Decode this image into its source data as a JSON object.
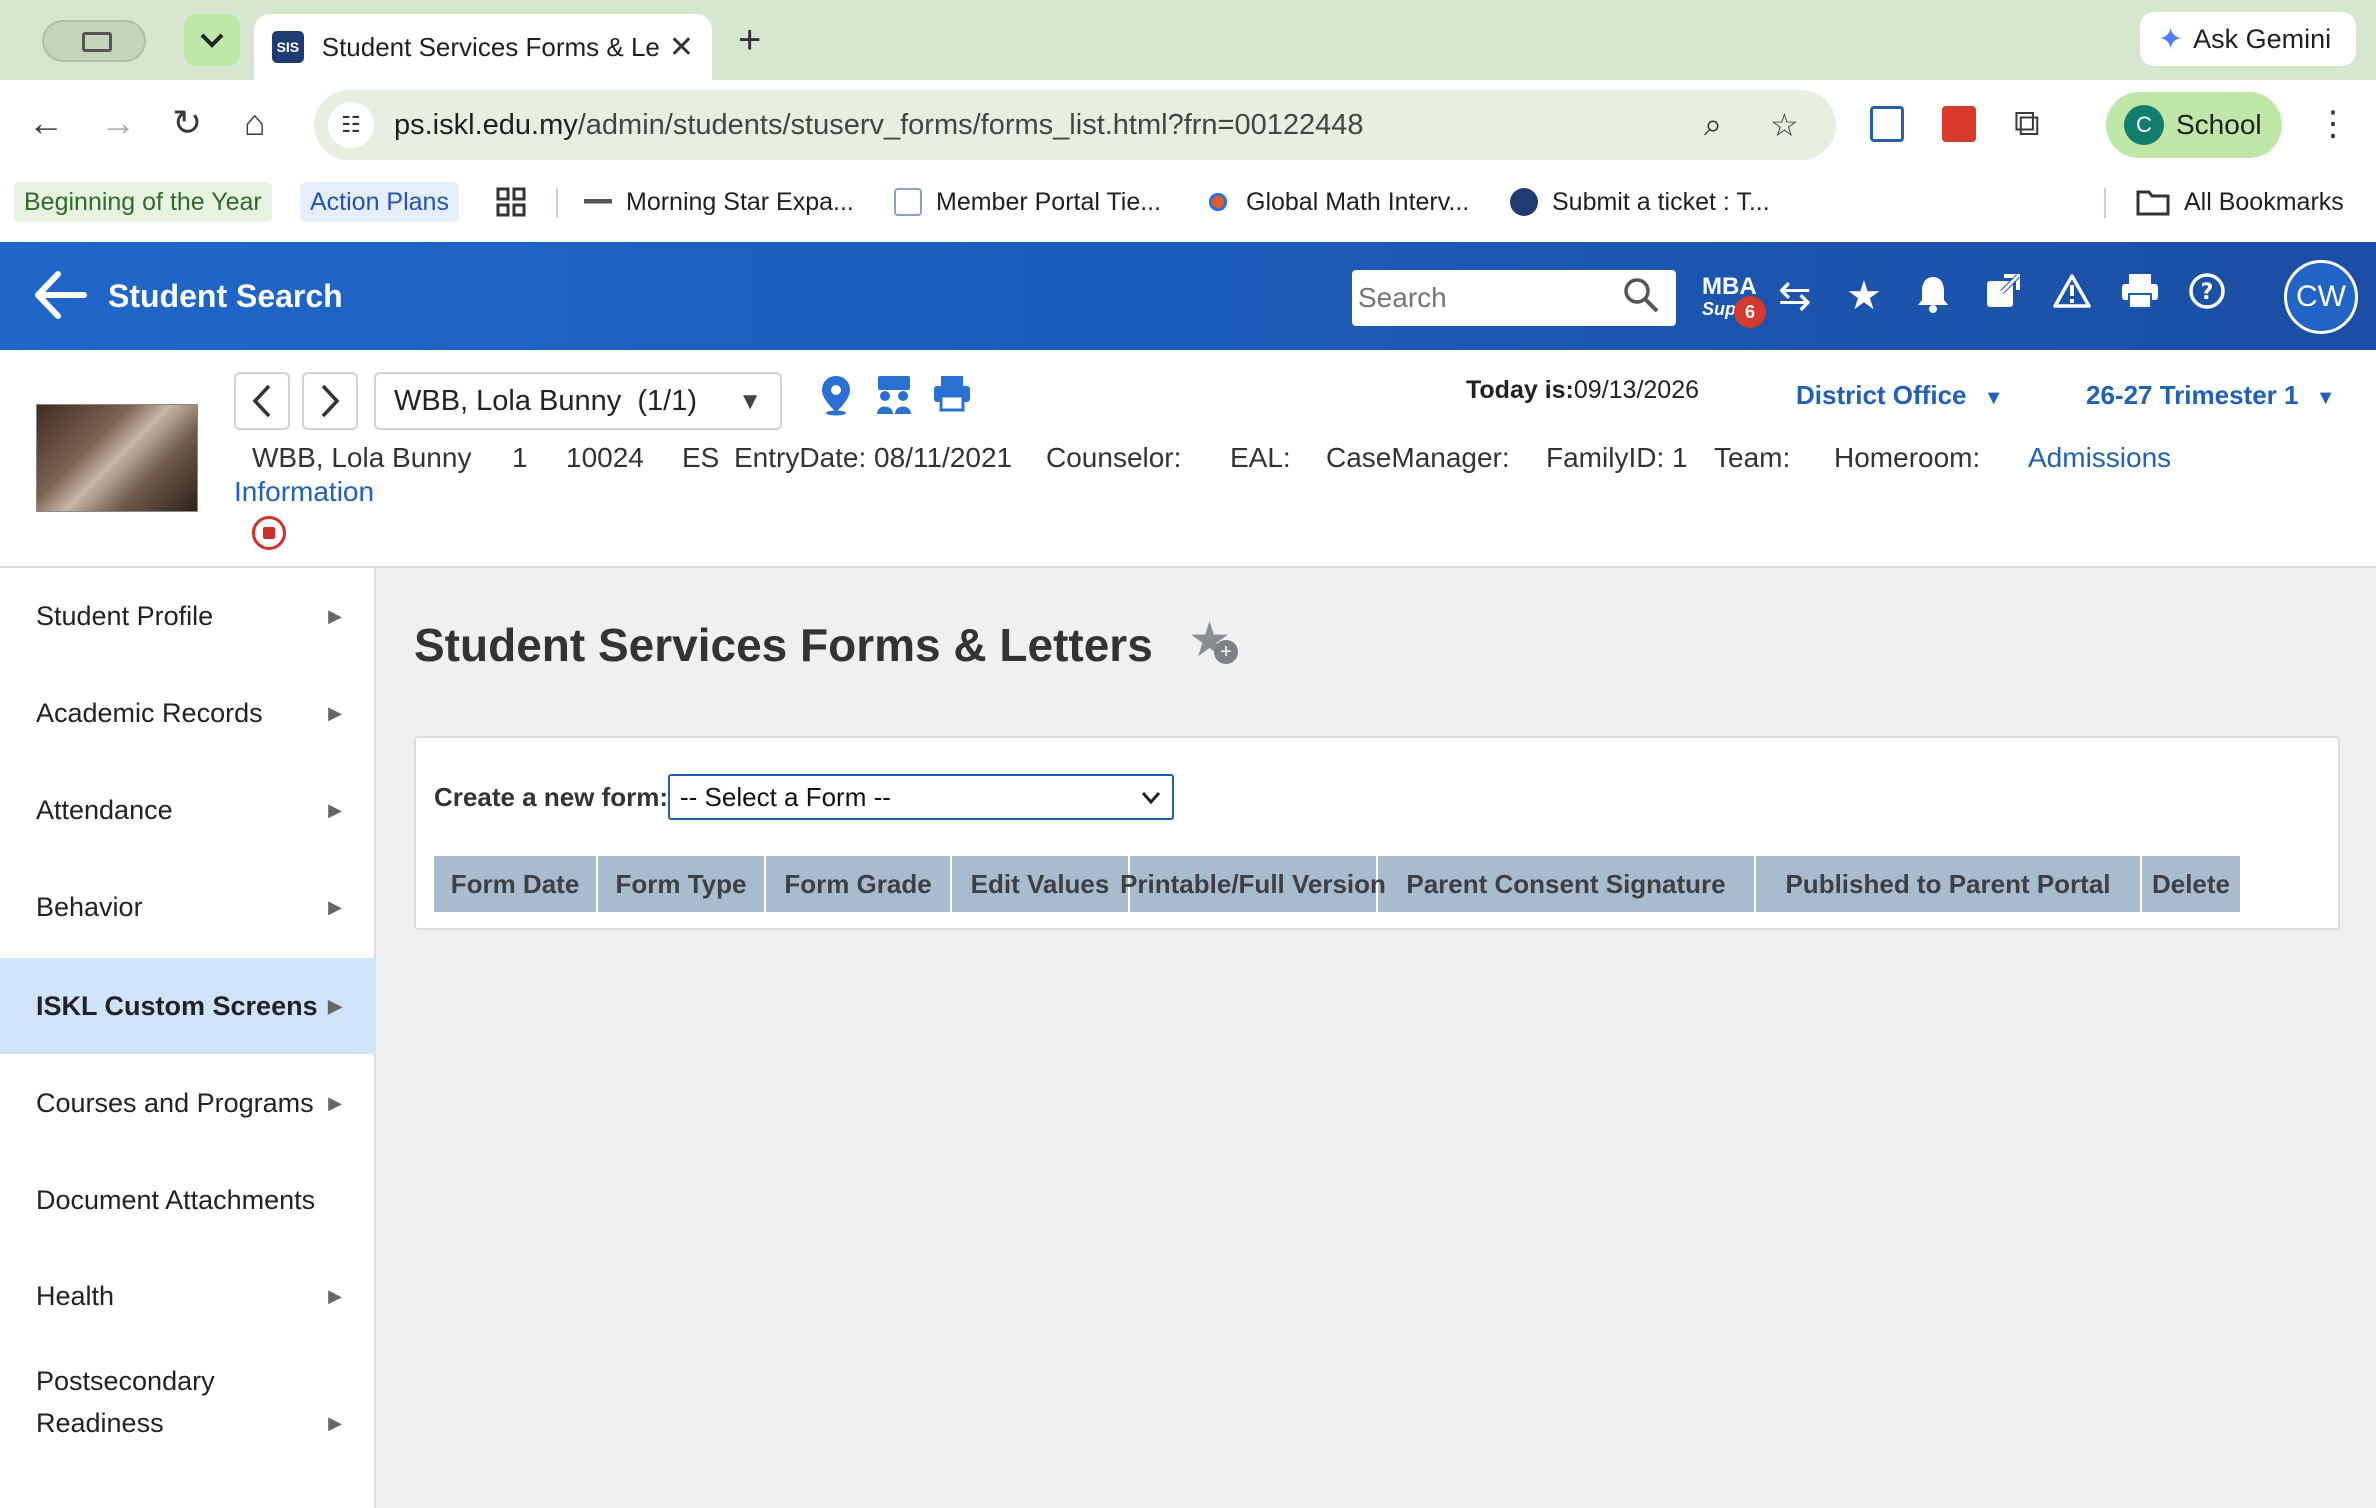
{
  "browser": {
    "tab": {
      "favicon_text": "SIS",
      "title": "Student Services Forms & Letters"
    },
    "gemini_label": "Ask Gemini",
    "url_host": "ps.iskl.edu.my",
    "url_path": "/admin/students/stuserv_forms/forms_list.html?frn=00122448",
    "profile": {
      "initial": "C",
      "label": "School"
    },
    "bookmarks": [
      {
        "label": "Beginning of the Year"
      },
      {
        "label": "Action Plans"
      },
      {
        "label": "Morning Star Expa..."
      },
      {
        "label": "Member Portal Tie..."
      },
      {
        "label": "Global Math Interv..."
      },
      {
        "label": "Submit a ticket : T..."
      }
    ],
    "all_bookmarks": "All Bookmarks"
  },
  "header": {
    "title": "Student Search",
    "search_placeholder": "Search",
    "mba_line1": "MBA",
    "mba_line2": "Supp",
    "mba_badge": "6",
    "user_initials": "CW"
  },
  "student": {
    "selector_label": "WBB, Lola Bunny  (1/1)",
    "today_label": "Today is:",
    "today_value": "09/13/2026",
    "school": "District Office",
    "term": "26-27 Trimester 1",
    "info": {
      "name": "WBB, Lola Bunny",
      "grade": "1",
      "id": "10024",
      "school_abbr": "ES",
      "entry": "EntryDate: 08/11/2021",
      "counselor": "Counselor:",
      "eal": "EAL:",
      "case_manager": "CaseManager:",
      "family": "FamilyID: 1",
      "team": "Team:",
      "homeroom": "Homeroom:",
      "admissions_1": "Admissions",
      "admissions_2": "Information"
    }
  },
  "sidebar": {
    "items": [
      {
        "label": "Student Profile"
      },
      {
        "label": "Academic Records"
      },
      {
        "label": "Attendance"
      },
      {
        "label": "Behavior"
      },
      {
        "label": "ISKL Custom Screens"
      },
      {
        "label": "Courses and Programs"
      },
      {
        "label": "Document Attachments"
      },
      {
        "label": "Health"
      },
      {
        "label": "Postsecondary"
      },
      {
        "label": "Readiness"
      }
    ]
  },
  "main": {
    "title": "Student Services Forms & Letters",
    "create_label": "Create a new form:",
    "select_value": "-- Select a Form --",
    "columns": [
      "Form Date",
      "Form Type",
      "Form Grade",
      "Edit Values",
      "Printable/Full Version",
      "Parent Consent Signature",
      "Published to Parent Portal",
      "Delete"
    ]
  },
  "colors": {
    "header_blue": "#1d5bb8",
    "link_blue": "#2060b8",
    "active_nav": "#cfe3fb",
    "table_header": "#a9bccd"
  }
}
